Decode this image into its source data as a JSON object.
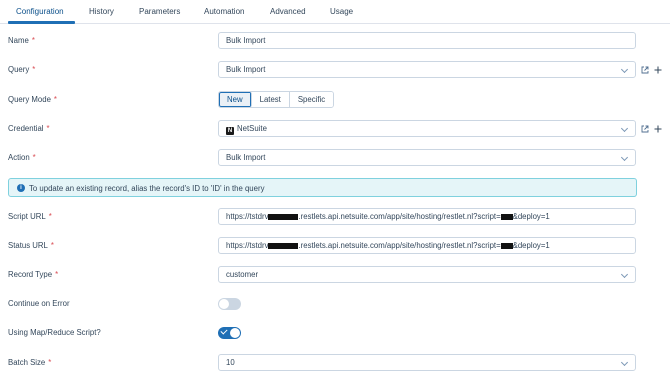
{
  "tabs": [
    {
      "label": "Configuration",
      "active": true
    },
    {
      "label": "History"
    },
    {
      "label": "Parameters"
    },
    {
      "label": "Automation"
    },
    {
      "label": "Advanced"
    },
    {
      "label": "Usage"
    }
  ],
  "required_marker": "*",
  "form": {
    "name": {
      "label": "Name",
      "value": "Bulk Import"
    },
    "query": {
      "label": "Query",
      "value": "Bulk Import"
    },
    "query_mode": {
      "label": "Query Mode",
      "options": [
        "New",
        "Latest",
        "Specific"
      ],
      "selected": "New"
    },
    "credential": {
      "label": "Credential",
      "logo_letter": "N",
      "value": "NetSuite"
    },
    "action": {
      "label": "Action",
      "value": "Bulk Import"
    },
    "info_banner": {
      "icon": "i",
      "text": "To update an existing record, alias the record's ID to 'ID' in the query"
    },
    "script_url": {
      "label": "Script URL",
      "prefix": "https://tstdrv",
      "middle": ".restlets.api.netsuite.com/app/site/hosting/restlet.nl?script=",
      "suffix": "&deploy=1"
    },
    "status_url": {
      "label": "Status URL",
      "prefix": "https://tstdrv",
      "middle": ".restlets.api.netsuite.com/app/site/hosting/restlet.nl?script=",
      "suffix": "&deploy=1"
    },
    "record_type": {
      "label": "Record Type",
      "value": "customer"
    },
    "continue_on_error": {
      "label": "Continue on Error",
      "enabled": false
    },
    "map_reduce": {
      "label": "Using Map/Reduce Script?",
      "enabled": true
    },
    "batch_size": {
      "label": "Batch Size",
      "value": "10"
    }
  },
  "colors": {
    "accent": "#1f6fb5",
    "required": "#d94c53",
    "info_bg": "#e5f5f8"
  },
  "icons": [
    "external-link-icon",
    "plus-icon",
    "info-icon",
    "chevron-down-icon",
    "netsuite-logo-icon",
    "check-icon"
  ]
}
